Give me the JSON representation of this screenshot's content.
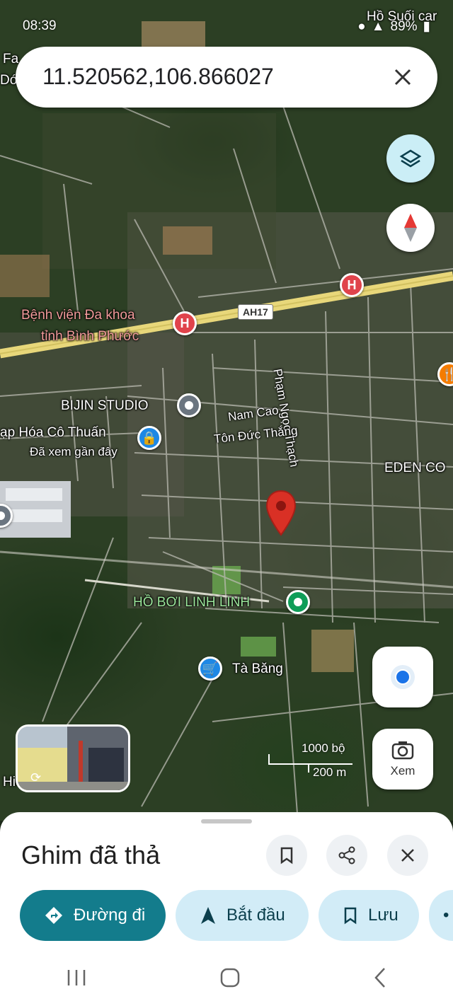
{
  "status_bar": {
    "time": "08:39",
    "battery": "89%"
  },
  "search": {
    "query": "11.520562,106.866027"
  },
  "map": {
    "labels": {
      "top_right": "Hồ Suối car",
      "top_left": "Fa",
      "top_left2": "Dói",
      "hospital": "Bệnh viện Đa khoa",
      "hospital2": "tỉnh Bình Phước",
      "highway": "AH17",
      "pham_ngoc_thach": "Phạm Ngọc Thạch",
      "bijin": "BIJIN STUDIO",
      "nam_cao": "Nam Cao",
      "ton_duc_thang": "Tôn Đức Thắng",
      "tap_hoa": "ạp Hóa Cô Thuấn",
      "da_xem": "Đã xem gần đây",
      "eden": "EDEN CO",
      "ho_boi": "HỒ BƠI LINH LINH",
      "ta_bang": "Tà Băng",
      "bottom_left": "Hiể"
    },
    "scale": {
      "feet": "1000 bộ",
      "meters": "200 m"
    },
    "street_view_button": "Xem"
  },
  "sheet": {
    "title": "Ghim đã thả",
    "actions": {
      "directions": "Đường đi",
      "start": "Bắt đầu",
      "save": "Lưu"
    }
  },
  "colors": {
    "primary": "#137c8c",
    "secondary": "#d2ecf7",
    "pin": "#d93025"
  }
}
